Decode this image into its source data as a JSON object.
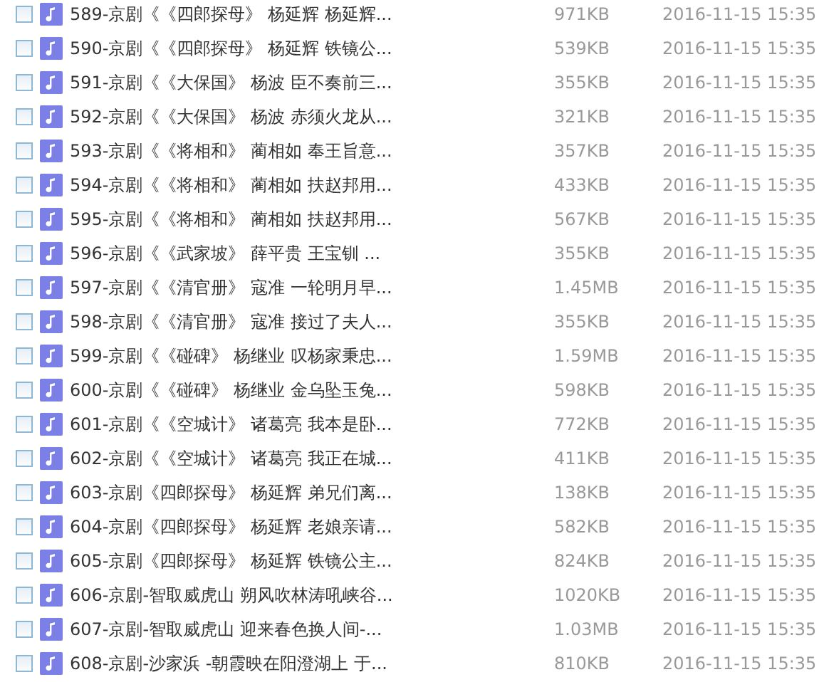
{
  "files": [
    {
      "name": "589-京剧《《四郎探母》 杨延辉 杨延辉...",
      "size": "971KB",
      "date": "2016-11-15 15:35",
      "checked": false
    },
    {
      "name": "590-京剧《《四郎探母》 杨延辉 铁镜公...",
      "size": "539KB",
      "date": "2016-11-15 15:35",
      "checked": false
    },
    {
      "name": "591-京剧《《大保国》 杨波 臣不奏前三...",
      "size": "355KB",
      "date": "2016-11-15 15:35",
      "checked": false
    },
    {
      "name": "592-京剧《《大保国》 杨波 赤须火龙从...",
      "size": "321KB",
      "date": "2016-11-15 15:35",
      "checked": false
    },
    {
      "name": "593-京剧《《将相和》 蔺相如 奉王旨意...",
      "size": "357KB",
      "date": "2016-11-15 15:35",
      "checked": false
    },
    {
      "name": "594-京剧《《将相和》 蔺相如 扶赵邦用...",
      "size": "433KB",
      "date": "2016-11-15 15:35",
      "checked": false
    },
    {
      "name": "595-京剧《《将相和》 蔺相如 扶赵邦用...",
      "size": "567KB",
      "date": "2016-11-15 15:35",
      "checked": false
    },
    {
      "name": "596-京剧《《武家坡》 薛平贵 王宝钏 ...",
      "size": "355KB",
      "date": "2016-11-15 15:35",
      "checked": false
    },
    {
      "name": "597-京剧《《清官册》 寇准 一轮明月早...",
      "size": "1.45MB",
      "date": "2016-11-15 15:35",
      "checked": false
    },
    {
      "name": "598-京剧《《清官册》 寇准 接过了夫人...",
      "size": "355KB",
      "date": "2016-11-15 15:35",
      "checked": false
    },
    {
      "name": "599-京剧《《碰碑》 杨继业 叹杨家秉忠...",
      "size": "1.59MB",
      "date": "2016-11-15 15:35",
      "checked": false
    },
    {
      "name": "600-京剧《《碰碑》 杨继业 金乌坠玉兔...",
      "size": "598KB",
      "date": "2016-11-15 15:35",
      "checked": false
    },
    {
      "name": "601-京剧《《空城计》 诸葛亮 我本是卧...",
      "size": "772KB",
      "date": "2016-11-15 15:35",
      "checked": false
    },
    {
      "name": "602-京剧《《空城计》 诸葛亮 我正在城...",
      "size": "411KB",
      "date": "2016-11-15 15:35",
      "checked": false
    },
    {
      "name": "603-京剧《四郎探母》 杨延辉 弟兄们离...",
      "size": "138KB",
      "date": "2016-11-15 15:35",
      "checked": false
    },
    {
      "name": "604-京剧《四郎探母》 杨延辉 老娘亲请...",
      "size": "582KB",
      "date": "2016-11-15 15:35",
      "checked": false
    },
    {
      "name": "605-京剧《四郎探母》 杨延辉 铁镜公主...",
      "size": "824KB",
      "date": "2016-11-15 15:35",
      "checked": false
    },
    {
      "name": "606-京剧-智取威虎山 朔风吹林涛吼峡谷...",
      "size": "1020KB",
      "date": "2016-11-15 15:35",
      "checked": false
    },
    {
      "name": "607-京剧-智取威虎山 迎来春色换人间-...",
      "size": "1.03MB",
      "date": "2016-11-15 15:35",
      "checked": false
    },
    {
      "name": "608-京剧-沙家浜 -朝霞映在阳澄湖上 于...",
      "size": "810KB",
      "date": "2016-11-15 15:35",
      "checked": false
    }
  ]
}
